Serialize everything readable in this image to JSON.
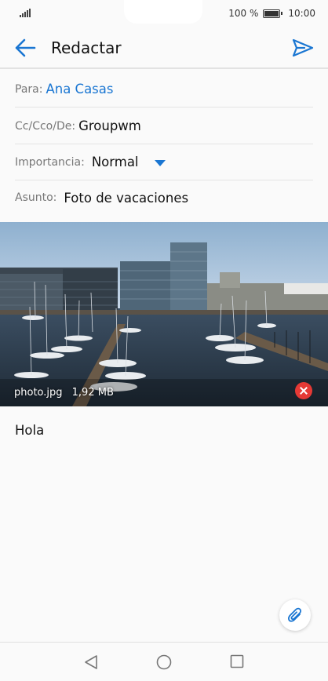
{
  "status_bar": {
    "battery_text": "100 %",
    "time": "10:00",
    "icons": [
      "signal-icon",
      "battery-icon"
    ]
  },
  "header": {
    "title": "Redactar",
    "back_icon": "arrow-left-icon",
    "send_icon": "send-icon",
    "accent": "#1a76d2"
  },
  "fields": {
    "to": {
      "label": "Para:",
      "value": "Ana Casas"
    },
    "cc": {
      "label": "Cc/Cco/De:",
      "value": "Groupwm"
    },
    "importance": {
      "label": "Importancia:",
      "value": "Normal"
    },
    "subject": {
      "label": "Asunto:",
      "value": "Foto de vacaciones"
    }
  },
  "attachment": {
    "filename": "photo.jpg",
    "size": "1,92 MB",
    "remove_color": "#e53935"
  },
  "body": {
    "text": "Hola"
  },
  "nav": {
    "icons": [
      "back-triangle-icon",
      "home-circle-icon",
      "recents-square-icon"
    ]
  }
}
